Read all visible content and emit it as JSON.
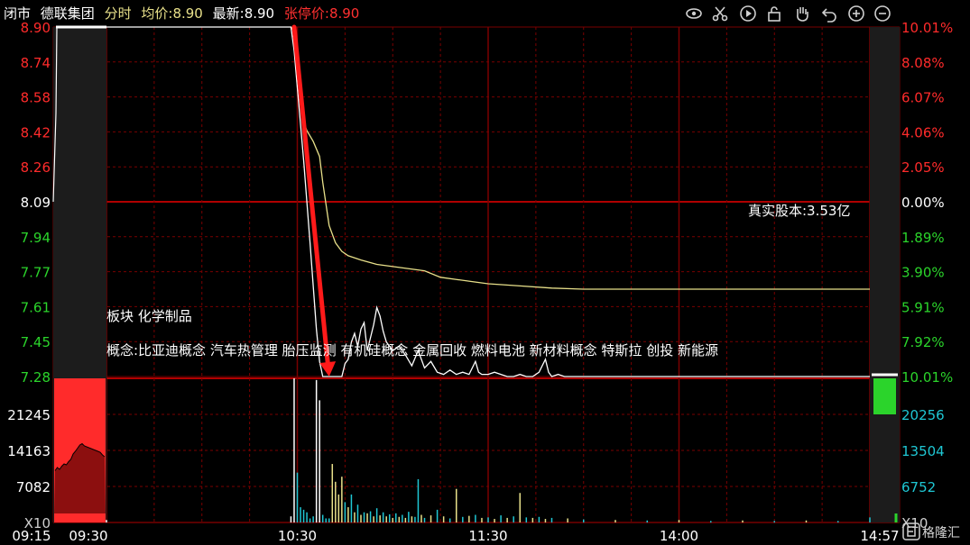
{
  "header": {
    "status": "闭市",
    "name": "德联集团",
    "mode": "分时",
    "avg_label": "均价:",
    "avg_value": "8.90",
    "last_label": "最新:",
    "last_value": "8.90",
    "limit_label": "张停价:",
    "limit_value": "8.90"
  },
  "toolbar": [
    "eye-icon",
    "scissors-icon",
    "play-icon",
    "lock-icon",
    "hand-icon",
    "undo-icon",
    "zoom-in-icon",
    "zoom-out-icon"
  ],
  "overlay": {
    "share_capital": "真实股本:3.53亿",
    "sector": "板块 化学制品",
    "concepts": "概念:比亚迪概念 汽车热管理 胎压监测 有机硅概念 金属回收 燃料电池 新材料概念 特斯拉 创投 新能源"
  },
  "watermark": "格隆汇",
  "colors": {
    "up": "#ff2b2b",
    "down": "#2bd42b",
    "neutral": "#ffffff",
    "volume_axis": "#1fc7d4",
    "avg_line": "#e8e08a",
    "grid": "#7a0000",
    "arrow": "#ff1a1a"
  },
  "chart_data": {
    "type": "line",
    "price_axis_left": [
      "8.90",
      "8.74",
      "8.58",
      "8.42",
      "8.26",
      "8.09",
      "7.94",
      "7.77",
      "7.61",
      "7.45",
      "7.28"
    ],
    "pct_axis_right": [
      "10.01%",
      "8.08%",
      "6.07%",
      "4.06%",
      "2.05%",
      "0.00%",
      "1.89%",
      "3.90%",
      "5.91%",
      "7.92%",
      "10.01%"
    ],
    "volume_axis_left": [
      "21245",
      "14163",
      "7082",
      "X10"
    ],
    "volume_axis_right": [
      "20256",
      "13504",
      "6752",
      "X10"
    ],
    "time_labels": [
      "09:15",
      "09:30",
      "10:30",
      "11:30",
      "14:00",
      "14:57"
    ],
    "price_range": [
      7.28,
      8.9
    ],
    "prev_close": 8.09,
    "volume_max": 28326,
    "price_series": [
      {
        "t": 0,
        "v": 8.9
      },
      {
        "t": 58,
        "v": 8.9
      },
      {
        "t": 59,
        "v": 8.79
      },
      {
        "t": 60,
        "v": 8.62
      },
      {
        "t": 61,
        "v": 8.45
      },
      {
        "t": 62,
        "v": 8.28
      },
      {
        "t": 63,
        "v": 8.09
      },
      {
        "t": 64,
        "v": 7.9
      },
      {
        "t": 65,
        "v": 7.7
      },
      {
        "t": 66,
        "v": 7.5
      },
      {
        "t": 67,
        "v": 7.35
      },
      {
        "t": 68,
        "v": 7.28
      },
      {
        "t": 69,
        "v": 7.28
      },
      {
        "t": 70,
        "v": 7.28
      },
      {
        "t": 72,
        "v": 7.28
      },
      {
        "t": 74,
        "v": 7.28
      },
      {
        "t": 75,
        "v": 7.34
      },
      {
        "t": 76,
        "v": 7.36
      },
      {
        "t": 77,
        "v": 7.44
      },
      {
        "t": 78,
        "v": 7.48
      },
      {
        "t": 79,
        "v": 7.42
      },
      {
        "t": 80,
        "v": 7.5
      },
      {
        "t": 81,
        "v": 7.53
      },
      {
        "t": 82,
        "v": 7.4
      },
      {
        "t": 83,
        "v": 7.46
      },
      {
        "t": 84,
        "v": 7.52
      },
      {
        "t": 85,
        "v": 7.6
      },
      {
        "t": 86,
        "v": 7.56
      },
      {
        "t": 87,
        "v": 7.49
      },
      {
        "t": 88,
        "v": 7.44
      },
      {
        "t": 90,
        "v": 7.4
      },
      {
        "t": 92,
        "v": 7.42
      },
      {
        "t": 94,
        "v": 7.38
      },
      {
        "t": 96,
        "v": 7.33
      },
      {
        "t": 98,
        "v": 7.4
      },
      {
        "t": 100,
        "v": 7.32
      },
      {
        "t": 102,
        "v": 7.35
      },
      {
        "t": 104,
        "v": 7.3
      },
      {
        "t": 106,
        "v": 7.29
      },
      {
        "t": 108,
        "v": 7.31
      },
      {
        "t": 110,
        "v": 7.29
      },
      {
        "t": 112,
        "v": 7.3
      },
      {
        "t": 114,
        "v": 7.29
      },
      {
        "t": 116,
        "v": 7.35
      },
      {
        "t": 117,
        "v": 7.3
      },
      {
        "t": 118,
        "v": 7.29
      },
      {
        "t": 120,
        "v": 7.29
      },
      {
        "t": 122,
        "v": 7.3
      },
      {
        "t": 124,
        "v": 7.29
      },
      {
        "t": 126,
        "v": 7.28
      },
      {
        "t": 128,
        "v": 7.28
      },
      {
        "t": 130,
        "v": 7.29
      },
      {
        "t": 132,
        "v": 7.28
      },
      {
        "t": 134,
        "v": 7.28
      },
      {
        "t": 136,
        "v": 7.3
      },
      {
        "t": 138,
        "v": 7.36
      },
      {
        "t": 139,
        "v": 7.3
      },
      {
        "t": 140,
        "v": 7.28
      },
      {
        "t": 142,
        "v": 7.29
      },
      {
        "t": 144,
        "v": 7.28
      },
      {
        "t": 146,
        "v": 7.28
      },
      {
        "t": 150,
        "v": 7.28
      },
      {
        "t": 155,
        "v": 7.28
      },
      {
        "t": 160,
        "v": 7.28
      },
      {
        "t": 165,
        "v": 7.28
      },
      {
        "t": 170,
        "v": 7.28
      },
      {
        "t": 175,
        "v": 7.28
      },
      {
        "t": 180,
        "v": 7.28
      },
      {
        "t": 185,
        "v": 7.28
      },
      {
        "t": 190,
        "v": 7.28
      },
      {
        "t": 195,
        "v": 7.28
      },
      {
        "t": 200,
        "v": 7.28
      },
      {
        "t": 205,
        "v": 7.28
      },
      {
        "t": 210,
        "v": 7.28
      },
      {
        "t": 215,
        "v": 7.28
      },
      {
        "t": 220,
        "v": 7.28
      },
      {
        "t": 225,
        "v": 7.28
      },
      {
        "t": 230,
        "v": 7.28
      },
      {
        "t": 235,
        "v": 7.28
      },
      {
        "t": 240,
        "v": 7.28
      }
    ],
    "avg_series": [
      {
        "t": 58,
        "v": 8.9
      },
      {
        "t": 59,
        "v": 8.88
      },
      {
        "t": 60,
        "v": 8.8
      },
      {
        "t": 61,
        "v": 8.6
      },
      {
        "t": 62,
        "v": 8.46
      },
      {
        "t": 63,
        "v": 8.42
      },
      {
        "t": 65,
        "v": 8.37
      },
      {
        "t": 67,
        "v": 8.3
      },
      {
        "t": 68,
        "v": 8.18
      },
      {
        "t": 69,
        "v": 8.08
      },
      {
        "t": 70,
        "v": 7.98
      },
      {
        "t": 72,
        "v": 7.9
      },
      {
        "t": 74,
        "v": 7.86
      },
      {
        "t": 76,
        "v": 7.84
      },
      {
        "t": 78,
        "v": 7.83
      },
      {
        "t": 80,
        "v": 7.82
      },
      {
        "t": 85,
        "v": 7.8
      },
      {
        "t": 90,
        "v": 7.79
      },
      {
        "t": 95,
        "v": 7.78
      },
      {
        "t": 100,
        "v": 7.77
      },
      {
        "t": 105,
        "v": 7.74
      },
      {
        "t": 110,
        "v": 7.73
      },
      {
        "t": 115,
        "v": 7.72
      },
      {
        "t": 120,
        "v": 7.71
      },
      {
        "t": 130,
        "v": 7.7
      },
      {
        "t": 140,
        "v": 7.69
      },
      {
        "t": 150,
        "v": 7.685
      },
      {
        "t": 160,
        "v": 7.685
      },
      {
        "t": 170,
        "v": 7.685
      },
      {
        "t": 180,
        "v": 7.685
      },
      {
        "t": 190,
        "v": 7.685
      },
      {
        "t": 200,
        "v": 7.685
      },
      {
        "t": 210,
        "v": 7.685
      },
      {
        "t": 220,
        "v": 7.685
      },
      {
        "t": 230,
        "v": 7.685
      },
      {
        "t": 240,
        "v": 7.685
      }
    ],
    "volume_bars": [
      {
        "t": 0,
        "v": 500,
        "c": "w"
      },
      {
        "t": 58,
        "v": 1200,
        "c": "w"
      },
      {
        "t": 59,
        "v": 28326,
        "c": "w"
      },
      {
        "t": 60,
        "v": 9800,
        "c": "c"
      },
      {
        "t": 61,
        "v": 3000,
        "c": "c"
      },
      {
        "t": 62,
        "v": 2500,
        "c": "c"
      },
      {
        "t": 63,
        "v": 2000,
        "c": "c"
      },
      {
        "t": 64,
        "v": 800,
        "c": "c"
      },
      {
        "t": 65,
        "v": 1200,
        "c": "c"
      },
      {
        "t": 66,
        "v": 28000,
        "c": "w"
      },
      {
        "t": 67,
        "v": 24000,
        "c": "w"
      },
      {
        "t": 68,
        "v": 1500,
        "c": "c"
      },
      {
        "t": 69,
        "v": 800,
        "c": "c"
      },
      {
        "t": 70,
        "v": 800,
        "c": "c"
      },
      {
        "t": 71,
        "v": 11500,
        "c": "y"
      },
      {
        "t": 72,
        "v": 8000,
        "c": "y"
      },
      {
        "t": 73,
        "v": 5500,
        "c": "y"
      },
      {
        "t": 74,
        "v": 9000,
        "c": "y"
      },
      {
        "t": 75,
        "v": 4000,
        "c": "c"
      },
      {
        "t": 76,
        "v": 3000,
        "c": "y"
      },
      {
        "t": 77,
        "v": 5500,
        "c": "c"
      },
      {
        "t": 78,
        "v": 2000,
        "c": "y"
      },
      {
        "t": 79,
        "v": 3500,
        "c": "c"
      },
      {
        "t": 80,
        "v": 1500,
        "c": "y"
      },
      {
        "t": 81,
        "v": 2000,
        "c": "c"
      },
      {
        "t": 82,
        "v": 1800,
        "c": "y"
      },
      {
        "t": 83,
        "v": 2200,
        "c": "c"
      },
      {
        "t": 84,
        "v": 1200,
        "c": "y"
      },
      {
        "t": 85,
        "v": 2800,
        "c": "c"
      },
      {
        "t": 86,
        "v": 1400,
        "c": "y"
      },
      {
        "t": 87,
        "v": 2000,
        "c": "c"
      },
      {
        "t": 88,
        "v": 1200,
        "c": "y"
      },
      {
        "t": 89,
        "v": 1600,
        "c": "c"
      },
      {
        "t": 90,
        "v": 900,
        "c": "y"
      },
      {
        "t": 91,
        "v": 1800,
        "c": "c"
      },
      {
        "t": 92,
        "v": 1100,
        "c": "y"
      },
      {
        "t": 93,
        "v": 1500,
        "c": "c"
      },
      {
        "t": 94,
        "v": 900,
        "c": "y"
      },
      {
        "t": 95,
        "v": 2100,
        "c": "c"
      },
      {
        "t": 96,
        "v": 1200,
        "c": "y"
      },
      {
        "t": 97,
        "v": 1100,
        "c": "c"
      },
      {
        "t": 98,
        "v": 8500,
        "c": "c"
      },
      {
        "t": 99,
        "v": 1500,
        "c": "y"
      },
      {
        "t": 100,
        "v": 900,
        "c": "c"
      },
      {
        "t": 102,
        "v": 1400,
        "c": "y"
      },
      {
        "t": 104,
        "v": 2500,
        "c": "c"
      },
      {
        "t": 106,
        "v": 1200,
        "c": "y"
      },
      {
        "t": 108,
        "v": 800,
        "c": "c"
      },
      {
        "t": 110,
        "v": 6600,
        "c": "y"
      },
      {
        "t": 112,
        "v": 1100,
        "c": "c"
      },
      {
        "t": 114,
        "v": 1300,
        "c": "y"
      },
      {
        "t": 116,
        "v": 1500,
        "c": "c"
      },
      {
        "t": 118,
        "v": 900,
        "c": "y"
      },
      {
        "t": 120,
        "v": 1000,
        "c": "c"
      },
      {
        "t": 122,
        "v": 700,
        "c": "y"
      },
      {
        "t": 124,
        "v": 1400,
        "c": "c"
      },
      {
        "t": 126,
        "v": 900,
        "c": "y"
      },
      {
        "t": 128,
        "v": 1200,
        "c": "c"
      },
      {
        "t": 130,
        "v": 5800,
        "c": "y"
      },
      {
        "t": 132,
        "v": 1000,
        "c": "c"
      },
      {
        "t": 134,
        "v": 900,
        "c": "y"
      },
      {
        "t": 136,
        "v": 1100,
        "c": "c"
      },
      {
        "t": 138,
        "v": 700,
        "c": "y"
      },
      {
        "t": 140,
        "v": 900,
        "c": "c"
      },
      {
        "t": 145,
        "v": 800,
        "c": "y"
      },
      {
        "t": 150,
        "v": 600,
        "c": "c"
      },
      {
        "t": 160,
        "v": 500,
        "c": "y"
      },
      {
        "t": 170,
        "v": 400,
        "c": "c"
      },
      {
        "t": 180,
        "v": 500,
        "c": "y"
      },
      {
        "t": 190,
        "v": 300,
        "c": "c"
      },
      {
        "t": 200,
        "v": 400,
        "c": "y"
      },
      {
        "t": 210,
        "v": 300,
        "c": "c"
      },
      {
        "t": 220,
        "v": 400,
        "c": "y"
      },
      {
        "t": 230,
        "v": 300,
        "c": "c"
      },
      {
        "t": 240,
        "v": 1000,
        "c": "c"
      }
    ],
    "auction_open_volume_profile": [
      0.35,
      0.42,
      0.38,
      0.45,
      0.5,
      0.48,
      0.55,
      0.6,
      0.72,
      0.78,
      0.85,
      0.92,
      0.95,
      0.9,
      0.88,
      0.86,
      0.84,
      0.82,
      0.8,
      0.78,
      0.76,
      0.7,
      0.66
    ],
    "auction_close_volume_level": 0.5,
    "annotation": {
      "type": "arrow",
      "from_t": 59,
      "from_v": 8.9,
      "to_t": 70,
      "to_v": 7.28
    }
  }
}
